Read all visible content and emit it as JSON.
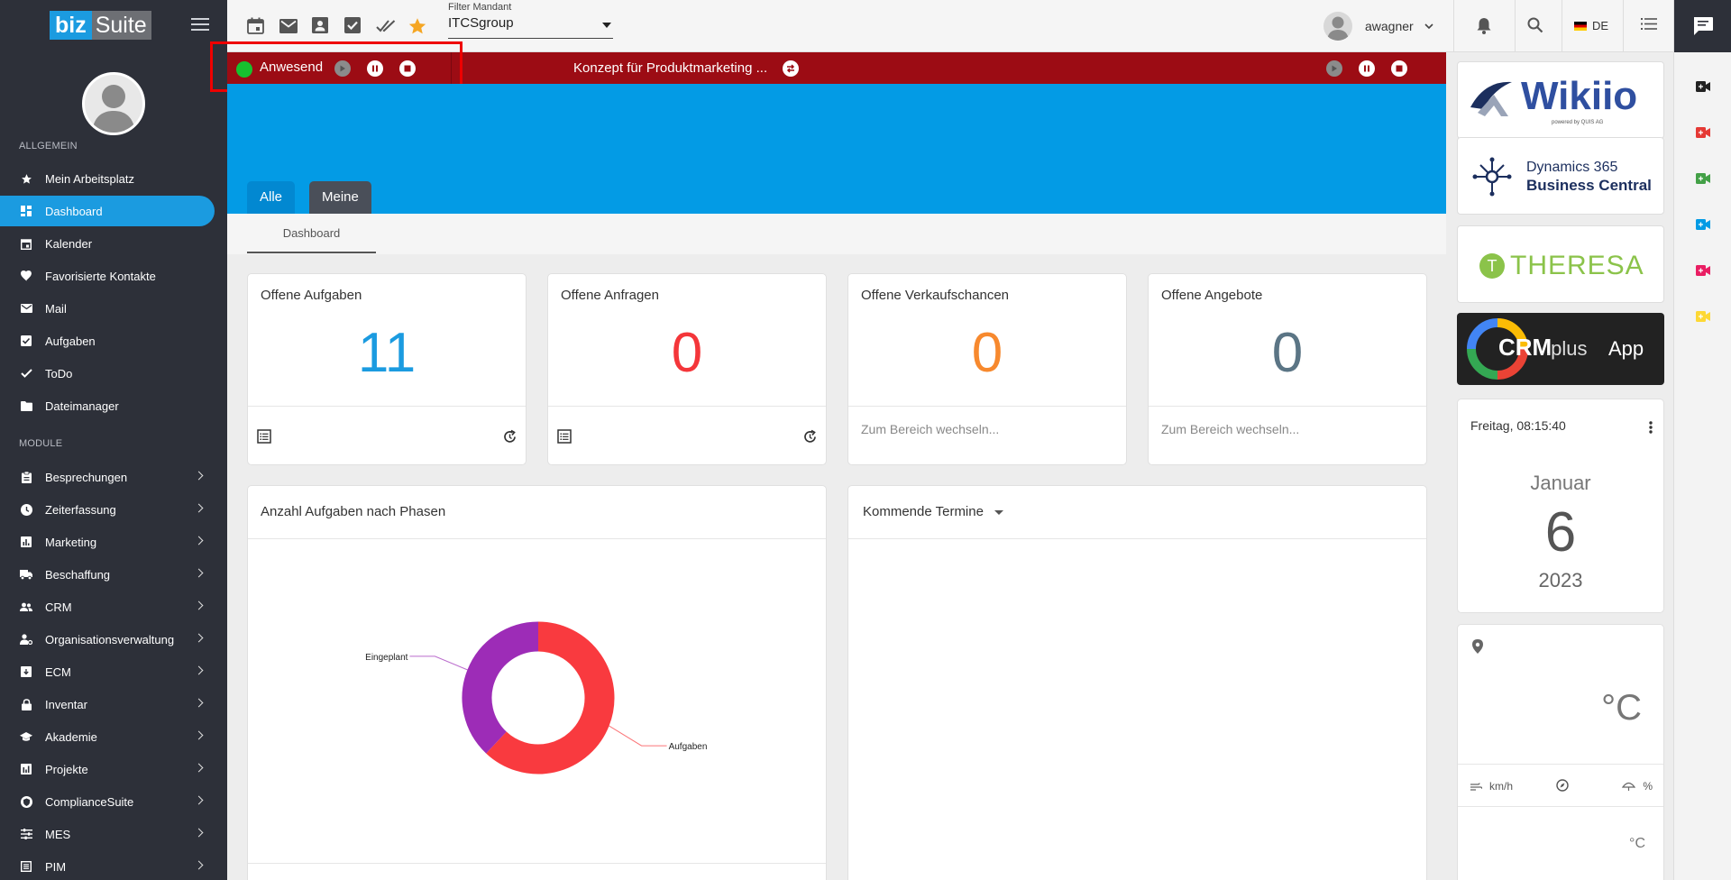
{
  "logo": {
    "left": "biz",
    "right": "Suite"
  },
  "sidebar": {
    "section_general": "ALLGEMEIN",
    "section_modules": "MODULE",
    "general_items": [
      {
        "label": "Mein Arbeitsplatz",
        "icon": "star-icon"
      },
      {
        "label": "Dashboard",
        "icon": "dashboard-icon",
        "active": true
      },
      {
        "label": "Kalender",
        "icon": "calendar-icon"
      },
      {
        "label": "Favorisierte Kontakte",
        "icon": "heart-icon"
      },
      {
        "label": "Mail",
        "icon": "mail-icon"
      },
      {
        "label": "Aufgaben",
        "icon": "checkbox-icon"
      },
      {
        "label": "ToDo",
        "icon": "check-icon"
      },
      {
        "label": "Dateimanager",
        "icon": "folder-icon"
      }
    ],
    "module_items": [
      {
        "label": "Besprechungen",
        "icon": "clipboard-icon"
      },
      {
        "label": "Zeiterfassung",
        "icon": "clock-icon"
      },
      {
        "label": "Marketing",
        "icon": "bar-chart-icon"
      },
      {
        "label": "Beschaffung",
        "icon": "truck-icon"
      },
      {
        "label": "CRM",
        "icon": "people-icon"
      },
      {
        "label": "Organisationsverwaltung",
        "icon": "org-icon"
      },
      {
        "label": "ECM",
        "icon": "archive-icon"
      },
      {
        "label": "Inventar",
        "icon": "lock-icon"
      },
      {
        "label": "Akademie",
        "icon": "graduation-icon"
      },
      {
        "label": "Projekte",
        "icon": "project-chart-icon"
      },
      {
        "label": "ComplianceSuite",
        "icon": "shield-icon"
      },
      {
        "label": "MES",
        "icon": "sliders-icon"
      },
      {
        "label": "PIM",
        "icon": "list-box-icon"
      }
    ]
  },
  "topbar": {
    "filter_label": "Filter Mandant",
    "filter_value": "ITCSgroup",
    "user_name": "awagner",
    "language": "DE"
  },
  "timer": {
    "status": "Anwesend",
    "task_title": "Konzept für Produktmarketing ...",
    "status_color": "#17c12f",
    "bar_color": "#9c0c14"
  },
  "tabs": {
    "all": "Alle",
    "mine": "Meine",
    "dashboard": "Dashboard"
  },
  "cards": [
    {
      "title": "Offene Aufgaben",
      "value": "11",
      "color": "#1b9be0",
      "link": ""
    },
    {
      "title": "Offene Anfragen",
      "value": "0",
      "color": "#f4363a",
      "link": ""
    },
    {
      "title": "Offene Verkaufschancen",
      "value": "0",
      "color": "#f7892e",
      "link": "Zum Bereich wechseln..."
    },
    {
      "title": "Offene Angebote",
      "value": "0",
      "color": "#5b7585",
      "link": "Zum Bereich wechseln..."
    }
  ],
  "chart_panel": {
    "title": "Anzahl Aufgaben nach Phasen"
  },
  "appointments": {
    "title": "Kommende Termine"
  },
  "chart_data": {
    "type": "pie",
    "categories": [
      "Aufgaben",
      "Eingeplant"
    ],
    "values": [
      62,
      38
    ],
    "colors": [
      "#f93a3f",
      "#9d2cb7"
    ]
  },
  "brands": {
    "wikiio": "Wikiio",
    "wikiio_sub": "powered by QUIS AG",
    "dynamics_1": "Dynamics 365",
    "dynamics_2": "Business Central",
    "theresa": "THERESA",
    "crm": "CRM",
    "crm_plus": ".plus",
    "crm_app": "App"
  },
  "clock": {
    "datetime": "Freitag, 08:15:40",
    "month": "Januar",
    "day": "6",
    "year": "2023"
  },
  "weather": {
    "temp_unit": "°C",
    "wind_unit": "km/h",
    "humidity_unit": "%",
    "temp_unit_small": "°C"
  }
}
